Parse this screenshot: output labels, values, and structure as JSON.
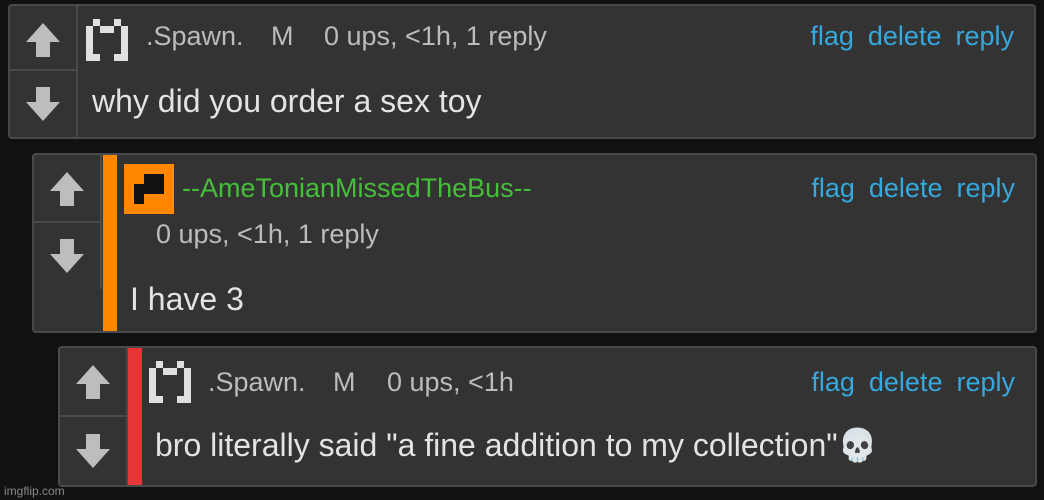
{
  "colors": {
    "link": "#35a8dd",
    "green_user": "#45bf3a",
    "accent_orange": "#ff8800",
    "accent_red": "#e53535",
    "panel_bg": "#333333",
    "page_bg": "#111111"
  },
  "comments": [
    {
      "username": ".Spawn.",
      "badge": "M",
      "meta": "0 ups, <1h, 1 reply",
      "body": "why did you order a sex toy",
      "avatar_icon": "pixel-avatar-icon",
      "actions": [
        "flag",
        "delete",
        "reply"
      ]
    },
    {
      "username": "--AmeTonianMissedTheBus--",
      "meta": "0 ups, <1h, 1 reply",
      "body": "I have 3",
      "avatar_icon": "orange-square-avatar-icon",
      "accent": "orange",
      "actions": [
        "flag",
        "delete",
        "reply"
      ]
    },
    {
      "username": ".Spawn.",
      "badge": "M",
      "meta": "0 ups, <1h",
      "body": "bro literally said \"a fine addition to my collection\"💀",
      "avatar_icon": "pixel-avatar-icon",
      "accent": "red",
      "actions": [
        "flag",
        "delete",
        "reply"
      ]
    }
  ],
  "watermark": "imgflip.com"
}
